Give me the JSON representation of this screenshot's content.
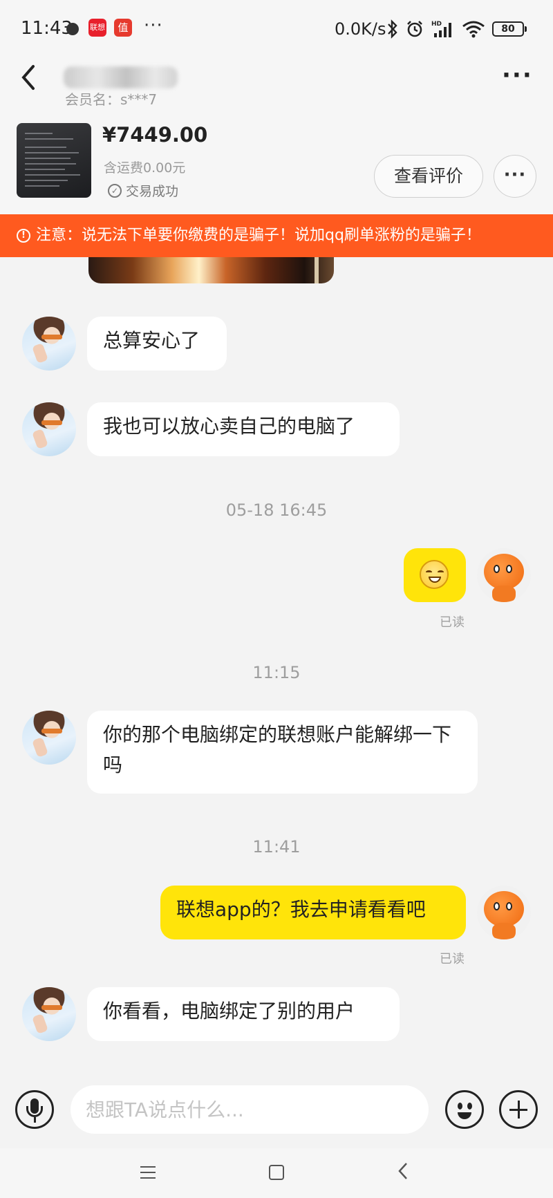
{
  "status_bar": {
    "time": "11:43",
    "app_badges": [
      {
        "name": "lenovo-app-icon",
        "label": "联想",
        "color": "#e8202c"
      },
      {
        "name": "zhide-app-icon",
        "label": "值",
        "color": "#e63a2e"
      }
    ],
    "more": "···",
    "network_speed": "0.0K/s",
    "battery": "80"
  },
  "header": {
    "back_icon": "chevron-left-icon",
    "member_name": "会员名：s***7",
    "more": "···"
  },
  "product": {
    "price": "¥7449.00",
    "shipping": "含运费0.00元",
    "status": "交易成功",
    "review_button": "查看评价",
    "more_button": "···"
  },
  "warning": {
    "icon": "!",
    "text": "注意：说无法下单要你缴费的是骗子！说加qq刷单涨粉的是骗子！"
  },
  "messages": {
    "m1": "总算安心了",
    "m2": "我也可以放心卖自己的电脑了",
    "ts1": "05-18 16:45",
    "read1": "已读",
    "ts2": "11:15",
    "m3": "你的那个电脑绑定的联想账户能解绑一下吗",
    "ts3": "11:41",
    "m4": "联想app的？我去申请看看吧",
    "read2": "已读",
    "m5": "你看看，电脑绑定了别的用户"
  },
  "input": {
    "placeholder": "想跟TA说点什么..."
  },
  "colors": {
    "warning_bg": "#ff5a1f",
    "outgoing_bubble": "#ffe40a",
    "incoming_bubble": "#ffffff"
  }
}
